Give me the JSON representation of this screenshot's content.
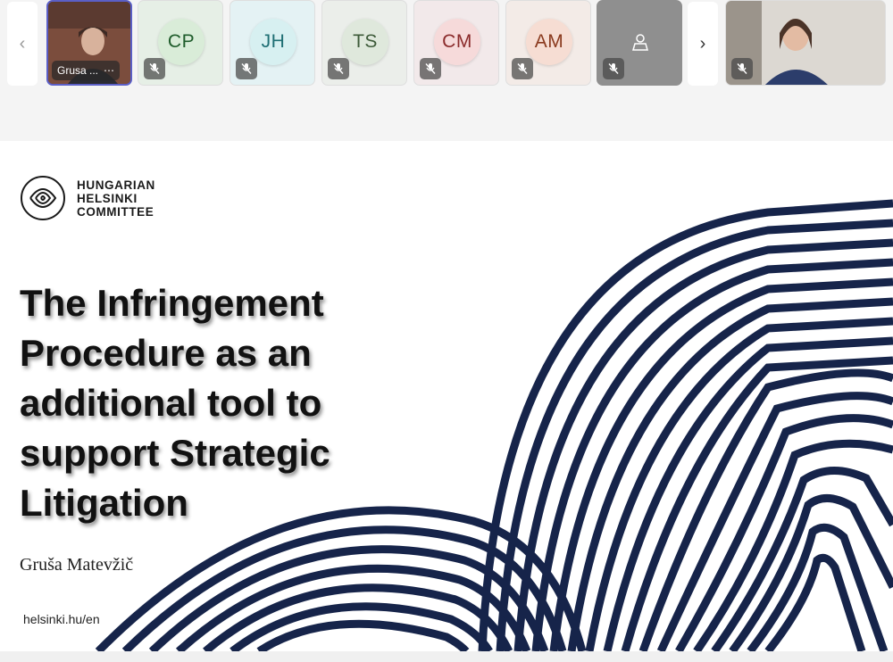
{
  "participants": [
    {
      "name": "Grusa ...",
      "video": true,
      "active": true,
      "more": "⋯"
    },
    {
      "initials": "CP",
      "bg": "#e6efe6",
      "circle": "#d9ecd8",
      "color": "#1f5c2b",
      "muted": true
    },
    {
      "initials": "JH",
      "bg": "#e4f2f4",
      "circle": "#d7f0f1",
      "color": "#1f6f74",
      "muted": true
    },
    {
      "initials": "TS",
      "bg": "#ebeeea",
      "circle": "#dfe8dc",
      "color": "#3d5a39",
      "muted": true
    },
    {
      "initials": "CM",
      "bg": "#f2e9ea",
      "circle": "#f6dada",
      "color": "#8b2b2b",
      "muted": true
    },
    {
      "initials": "AM",
      "bg": "#f3ebe7",
      "circle": "#f6ddd3",
      "color": "#8a3a1e",
      "muted": true
    },
    {
      "icon": "person-placeholder-icon",
      "bg": "#8f8f8f",
      "muted": true
    }
  ],
  "self_view": {
    "muted": true,
    "video": true
  },
  "nav": {
    "prev": "‹",
    "next": "›"
  },
  "slide": {
    "logo": {
      "line1": "HUNGARIAN",
      "line2": "HELSINKI",
      "line3": "COMMITTEE"
    },
    "title_lines": [
      "The Infringement",
      "Procedure as an",
      "additional tool to",
      "support Strategic",
      "Litigation"
    ],
    "author": "Gruša Matevžič",
    "url": "helsinki.hu/en"
  },
  "colors": {
    "accent": "#5b5fc7",
    "wave": "#16244a"
  }
}
